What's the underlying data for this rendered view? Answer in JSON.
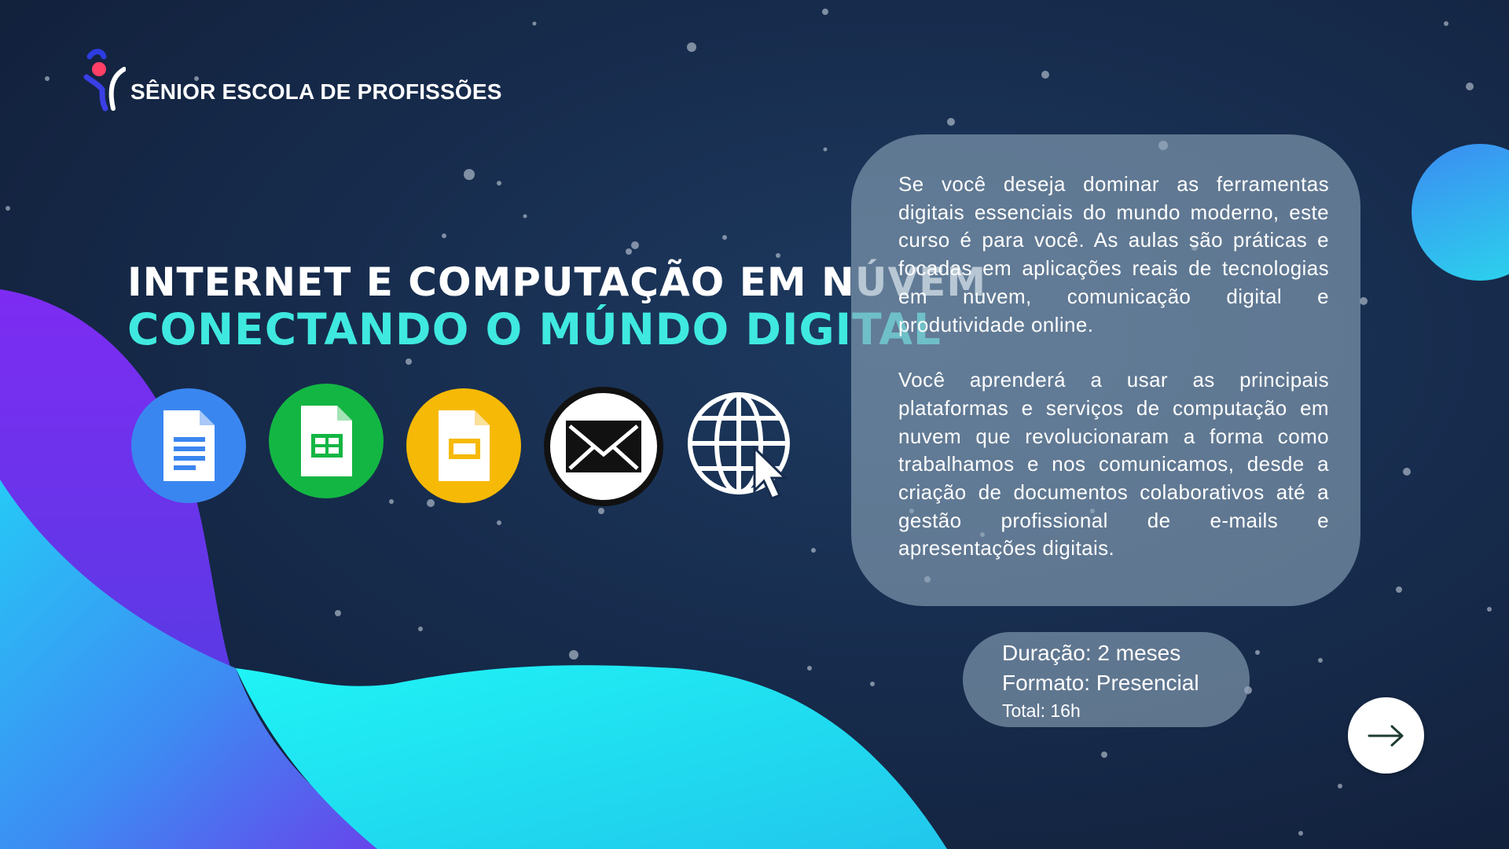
{
  "brand": {
    "name": "SÊNIOR ESCOLA DE PROFISSÕES",
    "logo_icon": "person-swoosh-logo-icon"
  },
  "headline": {
    "line1": "INTERNET E COMPUTAÇÃO EM NÚVEM",
    "line2": "CONECTANDO O MÚNDO DIGITAL"
  },
  "apps": [
    {
      "name": "docs-icon",
      "color": "#3a86f0"
    },
    {
      "name": "sheets-icon",
      "color": "#13b643"
    },
    {
      "name": "slides-icon",
      "color": "#f6b905"
    },
    {
      "name": "mail-icon",
      "color": "#ffffff"
    },
    {
      "name": "globe-cursor-icon",
      "color": "#ffffff"
    }
  ],
  "description": {
    "paragraph1": "Se você deseja dominar as ferramentas digitais essenciais do mundo moderno, este curso é para você. As aulas são práticas e focadas em aplicações reais de tecnologias em nuvem, comunicação digital e produtividade online.",
    "paragraph2": "Você aprenderá a usar as principais plataformas e serviços de computação em nuvem que revolucionaram a forma como trabalhamos e nos comunicamos, desde a criação de documentos colaborativos até a gestão profissional de e-mails e apresentações digitais."
  },
  "details": {
    "duration": "Duração: 2 meses",
    "format": "Formato: Presencial",
    "total": "Total: 16h"
  },
  "colors": {
    "accent": "#3fe9df",
    "background": "#172c4d",
    "wave_purple": "#7a2cf0",
    "wave_cyan": "#1ee8f2",
    "card": "#8ca5b9"
  },
  "navigation": {
    "next_icon": "arrow-right-icon"
  }
}
